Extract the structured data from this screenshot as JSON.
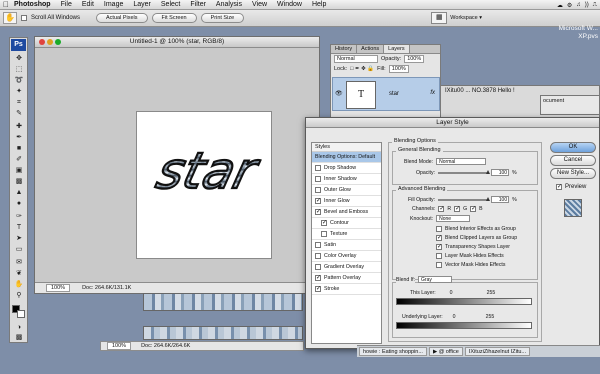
{
  "menubar": {
    "app": "Photoshop",
    "items": [
      "File",
      "Edit",
      "Image",
      "Layer",
      "Select",
      "Filter",
      "Analysis",
      "View",
      "Window",
      "Help"
    ],
    "extras": [
      "☁",
      "⚙",
      "♫",
      "))",
      "⎍"
    ]
  },
  "options": {
    "scroll_all": "Scroll All Windows",
    "actual_pixels": "Actual Pixels",
    "fit_screen": "Fit Screen",
    "print_size": "Print Size",
    "workspace": "Workspace ▾"
  },
  "desktop_right": {
    "line1": "Microsoft W...",
    "line2": "XP.pvs"
  },
  "document": {
    "title": "Untitled-1 @ 100% (star, RGB/8)",
    "canvas_text": "star",
    "zoom": "100%",
    "doc_info": "Doc: 264.6K/131.1K"
  },
  "document2": {
    "zoom": "100%",
    "doc_info": "Doc: 264.6K/264.6K"
  },
  "layers_panel": {
    "tabs": [
      "History",
      "Actions",
      "Layers"
    ],
    "blend_mode": "Normal",
    "opacity_label": "Opacity:",
    "opacity": "100%",
    "lock_label": "Lock:",
    "fill_label": "Fill:",
    "fill": "100%",
    "layer_thumb": "T",
    "layer_name": "star",
    "fx": "fx"
  },
  "bg_windows": {
    "win1_title": "IXitu00 ...  NO.3878 Hello !",
    "win2": "ocument"
  },
  "dialog": {
    "title": "Layer Style",
    "styles_header": "Styles",
    "styles": [
      {
        "label": "Blending Options: Default",
        "checkbox": false,
        "checked": false,
        "selected": true,
        "sub": false
      },
      {
        "label": "Drop Shadow",
        "checkbox": true,
        "checked": false,
        "selected": false,
        "sub": false
      },
      {
        "label": "Inner Shadow",
        "checkbox": true,
        "checked": false,
        "selected": false,
        "sub": false
      },
      {
        "label": "Outer Glow",
        "checkbox": true,
        "checked": false,
        "selected": false,
        "sub": false
      },
      {
        "label": "Inner Glow",
        "checkbox": true,
        "checked": true,
        "selected": false,
        "sub": false
      },
      {
        "label": "Bevel and Emboss",
        "checkbox": true,
        "checked": true,
        "selected": false,
        "sub": false
      },
      {
        "label": "Contour",
        "checkbox": true,
        "checked": true,
        "selected": false,
        "sub": true
      },
      {
        "label": "Texture",
        "checkbox": true,
        "checked": false,
        "selected": false,
        "sub": true
      },
      {
        "label": "Satin",
        "checkbox": true,
        "checked": false,
        "selected": false,
        "sub": false
      },
      {
        "label": "Color Overlay",
        "checkbox": true,
        "checked": false,
        "selected": false,
        "sub": false
      },
      {
        "label": "Gradient Overlay",
        "checkbox": true,
        "checked": false,
        "selected": false,
        "sub": false
      },
      {
        "label": "Pattern Overlay",
        "checkbox": true,
        "checked": true,
        "selected": false,
        "sub": false
      },
      {
        "label": "Stroke",
        "checkbox": true,
        "checked": true,
        "selected": false,
        "sub": false
      }
    ],
    "blending_options": "Blending Options",
    "general_blending": "General Blending",
    "blend_mode_label": "Blend Mode:",
    "blend_mode": "Normal",
    "opacity_label": "Opacity:",
    "opacity": "100",
    "opacity_fraction": 1.0,
    "advanced_blending": "Advanced Blending",
    "fill_opacity_label": "Fill Opacity:",
    "fill_opacity": "100",
    "channels_label": "Channels:",
    "channels": [
      "R",
      "G",
      "B"
    ],
    "knockout_label": "Knockout:",
    "knockout": "None",
    "advanced_checks": [
      {
        "label": "Blend Interior Effects as Group",
        "checked": false
      },
      {
        "label": "Blend Clipped Layers as Group",
        "checked": true
      },
      {
        "label": "Transparency Shapes Layer",
        "checked": true
      },
      {
        "label": "Layer Mask Hides Effects",
        "checked": false
      },
      {
        "label": "Vector Mask Hides Effects",
        "checked": false
      }
    ],
    "blend_if_label": "Blend If:",
    "blend_if": "Gray",
    "this_layer_label": "This Layer:",
    "underlying_label": "Underlying Layer:",
    "range_min": "0",
    "range_max": "255",
    "percent": "%",
    "buttons": {
      "ok": "OK",
      "cancel": "Cancel",
      "new_style": "New Style...",
      "preview": "Preview"
    }
  },
  "taskbar": {
    "items": [
      "howie : Eating shoppin...",
      "▶ @ office",
      "IXituziZihazelnut IZitu..."
    ]
  }
}
